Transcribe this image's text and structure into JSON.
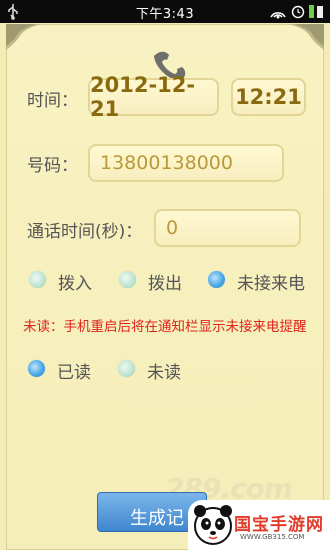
{
  "status_bar": {
    "time": "下午3:43"
  },
  "form": {
    "time_label": "时间：",
    "date_value": "2012-12-21",
    "time_value": "12:21",
    "number_label": "号码：",
    "number_value": "13800138000",
    "duration_label": "通话时间(秒)：",
    "duration_value": "0",
    "call_types": [
      {
        "label": "拨入",
        "selected": false
      },
      {
        "label": "拨出",
        "selected": false
      },
      {
        "label": "未接来电",
        "selected": true
      }
    ],
    "unread_note": "未读：手机重启后将在通知栏显示未接来电提醒",
    "read_states": [
      {
        "label": "已读",
        "selected": true
      },
      {
        "label": "未读",
        "selected": false
      }
    ],
    "generate_button": "生成记"
  },
  "watermark": {
    "text": "289.com"
  },
  "site_logo": {
    "title": "国宝手游网",
    "url": "WWW.GB315.COM"
  },
  "colors": {
    "accent_red": "#e0231c",
    "value_gold": "#8a6a10",
    "button_blue": "#3f86cf"
  }
}
